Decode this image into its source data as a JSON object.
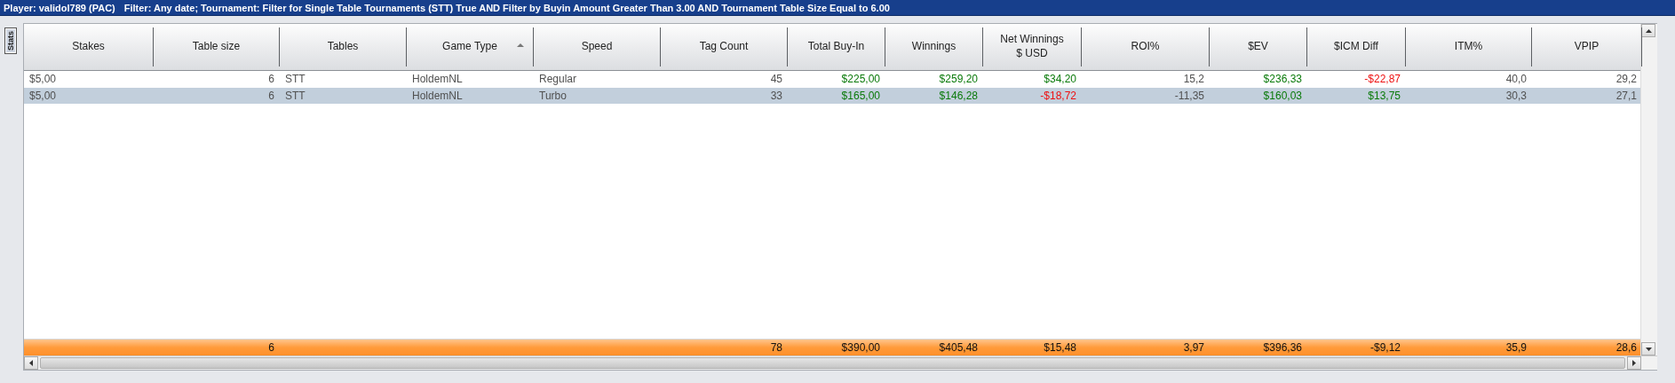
{
  "title_bar": {
    "player": "Player: validol789 (PAC)",
    "filter": "Filter: Any date; Tournament: Filter for Single Table Tournaments (STT) True AND Filter by Buyin Amount Greater Than 3.00 AND Tournament Table Size Equal to 6.00"
  },
  "side_tab": {
    "label": "Stats",
    "selected": true
  },
  "table": {
    "columns": [
      {
        "label": "Stakes",
        "sorted": false
      },
      {
        "label": "Table size",
        "sorted": false
      },
      {
        "label": "Tables",
        "sorted": false
      },
      {
        "label": "Game Type",
        "sorted": true
      },
      {
        "label": "Speed",
        "sorted": false
      },
      {
        "label": "Tag Count",
        "sorted": false
      },
      {
        "label": "Total Buy-In",
        "sorted": false
      },
      {
        "label": "Winnings",
        "sorted": false
      },
      {
        "label": "Net Winnings\n$ USD",
        "sorted": false
      },
      {
        "label": "ROI%",
        "sorted": false
      },
      {
        "label": "$EV",
        "sorted": false
      },
      {
        "label": "$ICM Diff",
        "sorted": false
      },
      {
        "label": "ITM%",
        "sorted": false
      },
      {
        "label": "VPIP",
        "sorted": false
      }
    ],
    "rows": [
      {
        "selected": false,
        "cells": [
          {
            "text": "$5,00",
            "color": "#505050"
          },
          {
            "text": "6",
            "color": "#505050"
          },
          {
            "text": "STT",
            "color": "#505050"
          },
          {
            "text": "HoldemNL",
            "color": "#505050"
          },
          {
            "text": "Regular",
            "color": "#505050"
          },
          {
            "text": "45",
            "color": "#505050"
          },
          {
            "text": "$225,00",
            "color": "#0a7a0a"
          },
          {
            "text": "$259,20",
            "color": "#0a7a0a"
          },
          {
            "text": "$34,20",
            "color": "#0a7a0a"
          },
          {
            "text": "15,2",
            "color": "#505050"
          },
          {
            "text": "$236,33",
            "color": "#0a7a0a"
          },
          {
            "text": "-$22,87",
            "color": "#ee1111"
          },
          {
            "text": "40,0",
            "color": "#505050"
          },
          {
            "text": "29,2",
            "color": "#505050"
          }
        ]
      },
      {
        "selected": true,
        "cells": [
          {
            "text": "$5,00",
            "color": "#505050"
          },
          {
            "text": "6",
            "color": "#505050"
          },
          {
            "text": "STT",
            "color": "#505050"
          },
          {
            "text": "HoldemNL",
            "color": "#505050"
          },
          {
            "text": "Turbo",
            "color": "#505050"
          },
          {
            "text": "33",
            "color": "#505050"
          },
          {
            "text": "$165,00",
            "color": "#0a7a0a"
          },
          {
            "text": "$146,28",
            "color": "#0a7a0a"
          },
          {
            "text": "-$18,72",
            "color": "#ee1111"
          },
          {
            "text": "-11,35",
            "color": "#505050"
          },
          {
            "text": "$160,03",
            "color": "#0a7a0a"
          },
          {
            "text": "$13,75",
            "color": "#0a7a0a"
          },
          {
            "text": "30,3",
            "color": "#505050"
          },
          {
            "text": "27,1",
            "color": "#505050"
          }
        ]
      }
    ],
    "totals": {
      "table_size": "6",
      "tag_count": "78",
      "total_buy_in": "$390,00",
      "winnings": "$405,48",
      "net_winnings": "$15,48",
      "roi": "3,97",
      "ev": "$396,36",
      "icm_diff": "-$9,12",
      "itm": "35,9",
      "vpip": "28,6"
    }
  }
}
